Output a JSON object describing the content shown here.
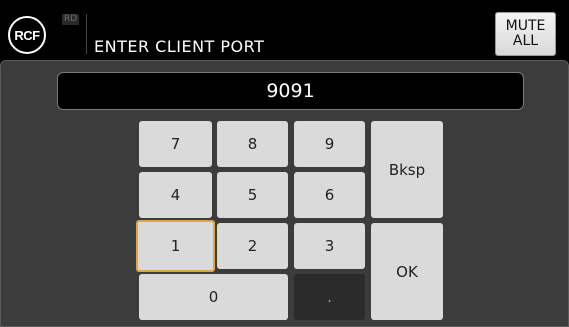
{
  "header": {
    "logo_text": "RCF",
    "badge_text": "RD",
    "title": "ENTER CLIENT PORT",
    "mute_button_label": "MUTE\nALL"
  },
  "display": {
    "value": "9091"
  },
  "keypad": {
    "k7": "7",
    "k8": "8",
    "k9": "9",
    "k4": "4",
    "k5": "5",
    "k6": "6",
    "k1": "1",
    "k2": "2",
    "k3": "3",
    "k0": "0",
    "dot": ".",
    "backspace": "Bksp",
    "ok": "OK"
  },
  "state": {
    "focused_key": "1"
  },
  "colors": {
    "focus_outline": "#e2a640",
    "key_face": "#dadada",
    "panel_bg": "#3c3c3c"
  }
}
